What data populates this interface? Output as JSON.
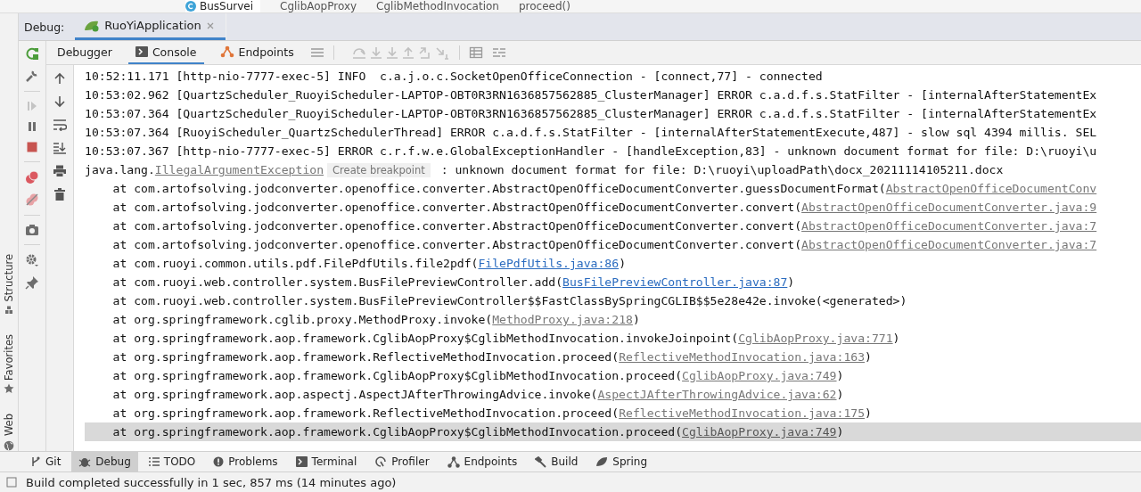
{
  "breadcrumb": {
    "file_tab": "BusSurvei",
    "path": [
      "CglibAopProxy",
      "CglibMethodInvocation",
      "proceed()"
    ]
  },
  "side_strip": [
    {
      "label": "Structure",
      "kind": "structure"
    },
    {
      "label": "Favorites",
      "kind": "favorites"
    },
    {
      "label": "Web",
      "kind": "web"
    }
  ],
  "debug_panel": {
    "label": "Debug:",
    "tabs": [
      {
        "label": "RuoYiApplication",
        "selected": true
      }
    ],
    "resume_enabled": false,
    "stepping_enabled": false
  },
  "toolbar_tabs": [
    {
      "label": "Debugger",
      "kind": "plain",
      "selected": false
    },
    {
      "label": "Console",
      "kind": "console",
      "selected": true
    },
    {
      "label": "Endpoints",
      "kind": "endpoints",
      "selected": false
    }
  ],
  "console": {
    "lines": [
      {
        "kind": "log",
        "highlighted": false,
        "segments": [
          {
            "kind": "text",
            "text": "10:52:11.171 [http-nio-7777-exec-5] INFO  c.a.j.o.c.SocketOpenOfficeConnection - [connect,77] - connected"
          }
        ]
      },
      {
        "kind": "log",
        "highlighted": false,
        "segments": [
          {
            "kind": "text",
            "text": "10:53:02.962 [QuartzScheduler_RuoyiScheduler-LAPTOP-OBT0R3RN1636857562885_ClusterManager] ERROR c.a.d.f.s.StatFilter - [internalAfterStatementEx"
          }
        ]
      },
      {
        "kind": "log",
        "highlighted": false,
        "segments": [
          {
            "kind": "text",
            "text": "10:53:07.364 [QuartzScheduler_RuoyiScheduler-LAPTOP-OBT0R3RN1636857562885_ClusterManager] ERROR c.a.d.f.s.StatFilter - [internalAfterStatementEx"
          }
        ]
      },
      {
        "kind": "log",
        "highlighted": false,
        "segments": [
          {
            "kind": "text",
            "text": "10:53:07.364 [RuoyiScheduler_QuartzSchedulerThread] ERROR c.a.d.f.s.StatFilter - [internalAfterStatementExecute,487] - slow sql 4394 millis. SEL"
          }
        ]
      },
      {
        "kind": "log",
        "highlighted": false,
        "segments": [
          {
            "kind": "text",
            "text": "10:53:07.367 [http-nio-7777-exec-5] ERROR c.r.f.w.e.GlobalExceptionHandler - [handleException,83] - unknown document format for file: D:\\ruoyi\\u"
          }
        ]
      },
      {
        "kind": "log",
        "highlighted": false,
        "segments": [
          {
            "kind": "text",
            "text": "java.lang."
          },
          {
            "kind": "library-link",
            "text": "IllegalArgumentException"
          },
          {
            "kind": "hint",
            "text": "Create breakpoint"
          },
          {
            "kind": "text",
            "text": " : unknown document format for file: D:\\ruoyi\\uploadPath\\docx_20211114105211.docx"
          }
        ]
      },
      {
        "kind": "frame",
        "highlighted": false,
        "segments": [
          {
            "kind": "text",
            "text": "at com.artofsolving.jodconverter.openoffice.converter.AbstractOpenOfficeDocumentConverter.guessDocumentFormat("
          },
          {
            "kind": "library-link",
            "text": "AbstractOpenOfficeDocumentConv"
          }
        ]
      },
      {
        "kind": "frame",
        "highlighted": false,
        "segments": [
          {
            "kind": "text",
            "text": "at com.artofsolving.jodconverter.openoffice.converter.AbstractOpenOfficeDocumentConverter.convert("
          },
          {
            "kind": "library-link",
            "text": "AbstractOpenOfficeDocumentConverter.java:9"
          }
        ]
      },
      {
        "kind": "frame",
        "highlighted": false,
        "segments": [
          {
            "kind": "text",
            "text": "at com.artofsolving.jodconverter.openoffice.converter.AbstractOpenOfficeDocumentConverter.convert("
          },
          {
            "kind": "library-link",
            "text": "AbstractOpenOfficeDocumentConverter.java:7"
          }
        ]
      },
      {
        "kind": "frame",
        "highlighted": false,
        "segments": [
          {
            "kind": "text",
            "text": "at com.artofsolving.jodconverter.openoffice.converter.AbstractOpenOfficeDocumentConverter.convert("
          },
          {
            "kind": "library-link",
            "text": "AbstractOpenOfficeDocumentConverter.java:7"
          }
        ]
      },
      {
        "kind": "frame",
        "highlighted": false,
        "segments": [
          {
            "kind": "text",
            "text": "at com.ruoyi.common.utils.pdf.FilePdfUtils.file2pdf("
          },
          {
            "kind": "link",
            "text": "FilePdfUtils.java:86"
          },
          {
            "kind": "text",
            "text": ")"
          }
        ]
      },
      {
        "kind": "frame",
        "highlighted": false,
        "segments": [
          {
            "kind": "text",
            "text": "at com.ruoyi.web.controller.system.BusFilePreviewController.add("
          },
          {
            "kind": "link",
            "text": "BusFilePreviewController.java:87"
          },
          {
            "kind": "text",
            "text": ")"
          }
        ]
      },
      {
        "kind": "frame",
        "highlighted": false,
        "segments": [
          {
            "kind": "text",
            "text": "at com.ruoyi.web.controller.system.BusFilePreviewController$$FastClassBySpringCGLIB$$5e28e42e.invoke(<generated>)"
          }
        ]
      },
      {
        "kind": "frame",
        "highlighted": false,
        "segments": [
          {
            "kind": "text",
            "text": "at org.springframework.cglib.proxy.MethodProxy.invoke("
          },
          {
            "kind": "library-link",
            "text": "MethodProxy.java:218"
          },
          {
            "kind": "text",
            "text": ")"
          }
        ]
      },
      {
        "kind": "frame",
        "highlighted": false,
        "segments": [
          {
            "kind": "text",
            "text": "at org.springframework.aop.framework.CglibAopProxy$CglibMethodInvocation.invokeJoinpoint("
          },
          {
            "kind": "library-link",
            "text": "CglibAopProxy.java:771"
          },
          {
            "kind": "text",
            "text": ")"
          }
        ]
      },
      {
        "kind": "frame",
        "highlighted": false,
        "segments": [
          {
            "kind": "text",
            "text": "at org.springframework.aop.framework.ReflectiveMethodInvocation.proceed("
          },
          {
            "kind": "library-link",
            "text": "ReflectiveMethodInvocation.java:163"
          },
          {
            "kind": "text",
            "text": ")"
          }
        ]
      },
      {
        "kind": "frame",
        "highlighted": false,
        "segments": [
          {
            "kind": "text",
            "text": "at org.springframework.aop.framework.CglibAopProxy$CglibMethodInvocation.proceed("
          },
          {
            "kind": "library-link",
            "text": "CglibAopProxy.java:749"
          },
          {
            "kind": "text",
            "text": ")"
          }
        ]
      },
      {
        "kind": "frame",
        "highlighted": false,
        "segments": [
          {
            "kind": "text",
            "text": "at org.springframework.aop.aspectj.AspectJAfterThrowingAdvice.invoke("
          },
          {
            "kind": "library-link",
            "text": "AspectJAfterThrowingAdvice.java:62"
          },
          {
            "kind": "text",
            "text": ")"
          }
        ]
      },
      {
        "kind": "frame",
        "highlighted": false,
        "segments": [
          {
            "kind": "text",
            "text": "at org.springframework.aop.framework.ReflectiveMethodInvocation.proceed("
          },
          {
            "kind": "library-link",
            "text": "ReflectiveMethodInvocation.java:175"
          },
          {
            "kind": "text",
            "text": ")"
          }
        ]
      },
      {
        "kind": "frame",
        "highlighted": true,
        "segments": [
          {
            "kind": "text",
            "text": "at org.springframework.aop.framework.CglibAopProxy$CglibMethodInvocation.proceed("
          },
          {
            "kind": "library-link",
            "text": "CglibAopProxy.java:749"
          },
          {
            "kind": "text",
            "text": ")"
          }
        ]
      }
    ]
  },
  "tool_windows": [
    {
      "label": "Git",
      "kind": "git",
      "selected": false
    },
    {
      "label": "Debug",
      "kind": "debug",
      "selected": true
    },
    {
      "label": "TODO",
      "kind": "todo",
      "selected": false
    },
    {
      "label": "Problems",
      "kind": "problems",
      "selected": false
    },
    {
      "label": "Terminal",
      "kind": "terminal",
      "selected": false
    },
    {
      "label": "Profiler",
      "kind": "profiler",
      "selected": false
    },
    {
      "label": "Endpoints",
      "kind": "endpoints",
      "selected": false
    },
    {
      "label": "Build",
      "kind": "build",
      "selected": false
    },
    {
      "label": "Spring",
      "kind": "spring",
      "selected": false
    }
  ],
  "status_bar": {
    "message": "Build completed successfully in 1 sec, 857 ms (14 minutes ago)"
  }
}
